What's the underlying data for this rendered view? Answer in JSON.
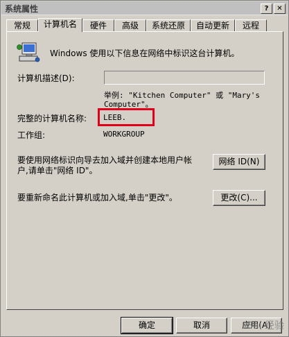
{
  "window": {
    "title": "系统属性"
  },
  "title_buttons": {
    "help": "?",
    "close": "✕"
  },
  "tabs": [
    {
      "label": "常规"
    },
    {
      "label": "计算机名"
    },
    {
      "label": "硬件"
    },
    {
      "label": "高级"
    },
    {
      "label": "系统还原"
    },
    {
      "label": "自动更新"
    },
    {
      "label": "远程"
    }
  ],
  "panel": {
    "intro_text": "Windows 使用以下信息在网络中标识这台计算机。",
    "description_label": "计算机描述(D):",
    "description_value": "",
    "example_line1": "举例: \"Kitchen Computer\" 或 \"Mary's",
    "example_line2": "Computer\"。",
    "full_name_label": "完整的计算机名称:",
    "full_name_value": "LEEB.",
    "workgroup_label": "工作组:",
    "workgroup_value": "WORKGROUP",
    "network_id_text_line1": "要使用网络标识向导去加入域并创建本地用户帐",
    "network_id_text_line2": "户,请单击\"网络 ID\"。",
    "network_id_button": "网络 ID(N)",
    "rename_text": "要重新命名此计算机或加入域,单击\"更改\"。",
    "change_button": "更改(C)..."
  },
  "footer": {
    "ok": "确定",
    "cancel": "取消",
    "apply": "应用(A)"
  },
  "watermark": "Bai 经验",
  "icons": {
    "computer": "computer-icon",
    "help": "help-icon",
    "close": "close-icon"
  },
  "colors": {
    "highlight_box": "#e0001a",
    "dialog_bg": "#d4d0c8"
  }
}
